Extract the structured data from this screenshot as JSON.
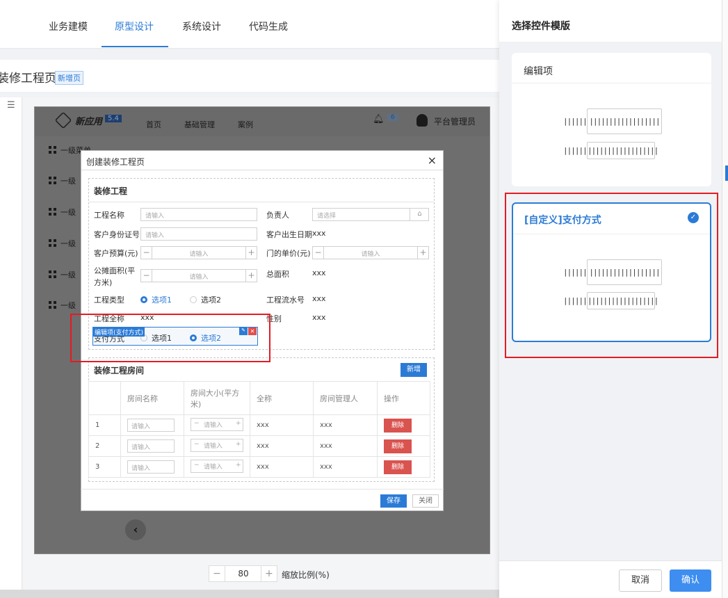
{
  "topnav": {
    "tabs": [
      "业务建模",
      "原型设计",
      "系统设计",
      "代码生成"
    ],
    "active_index": 1
  },
  "page": {
    "title": "装修工程页",
    "tag": "新增页"
  },
  "preview": {
    "app_name": "新应用",
    "version": "5.4",
    "nav": [
      "首页",
      "基础管理",
      "案例"
    ],
    "notify_count": "6",
    "user": "平台管理员",
    "menu_items": [
      "一级菜单",
      "一级",
      "一级",
      "一级",
      "一级",
      "一级"
    ],
    "collapse_icon": "‹"
  },
  "dialog": {
    "title": "创建装修工程页",
    "close": "×",
    "section1": {
      "title": "装修工程",
      "fields": {
        "name_label": "工程名称",
        "name_placeholder": "请输入",
        "owner_label": "负责人",
        "owner_placeholder": "请选择",
        "idcard_label": "客户身份证号",
        "idcard_placeholder": "请输入",
        "birth_label": "客户出生日期",
        "birth_value": "xxx",
        "budget_label": "客户预算(元)",
        "budget_placeholder": "请输入",
        "unitprice_label": "门的单价(元)",
        "unitprice_placeholder": "请输入",
        "sharedarea_label_1": "公摊面积(平",
        "sharedarea_label_2": "方米)",
        "sharedarea_placeholder": "请输入",
        "totalarea_label": "总面积",
        "totalarea_value": "xxx",
        "type_label": "工程类型",
        "type_opt1": "选项1",
        "type_opt2": "选项2",
        "serial_label": "工程流水号",
        "serial_value": "xxx",
        "fullname_label": "工程全称",
        "fullname_value": "xxx",
        "gender_label": "性别",
        "gender_value": "xxx",
        "pay_label": "支付方式",
        "pay_opt1": "选项1",
        "pay_opt2": "选项2"
      },
      "selected_tag": "编辑项(支付方式)"
    },
    "section2": {
      "title": "装修工程房间",
      "add_button": "新增",
      "headers": [
        "",
        "房间名称",
        "房间大小(平方米)",
        "全称",
        "房间管理人",
        "操作"
      ],
      "rows": [
        {
          "index": "1",
          "name_placeholder": "请输入",
          "size_placeholder": "请输入",
          "fullname": "xxx",
          "manager": "xxx",
          "action": "删除"
        },
        {
          "index": "2",
          "name_placeholder": "请输入",
          "size_placeholder": "请输入",
          "fullname": "xxx",
          "manager": "xxx",
          "action": "删除"
        },
        {
          "index": "3",
          "name_placeholder": "请输入",
          "size_placeholder": "请输入",
          "fullname": "xxx",
          "manager": "xxx",
          "action": "删除"
        }
      ]
    },
    "save": "保存",
    "close_button": "关闭"
  },
  "zoom": {
    "value": "80",
    "minus": "−",
    "plus": "+",
    "label": "缩放比例(%)"
  },
  "right_panel": {
    "title": "选择控件模版",
    "cards": [
      {
        "title": "编辑项",
        "selected": false
      },
      {
        "title": "[自定义]支付方式",
        "selected": true
      }
    ],
    "bar_short": "||||||",
    "bar_long": "||||||||||||||||||",
    "cancel": "取消",
    "confirm": "确认"
  },
  "colors": {
    "accent": "#2b7bd6",
    "highlight": "#e31b23",
    "danger": "#d9534f"
  }
}
